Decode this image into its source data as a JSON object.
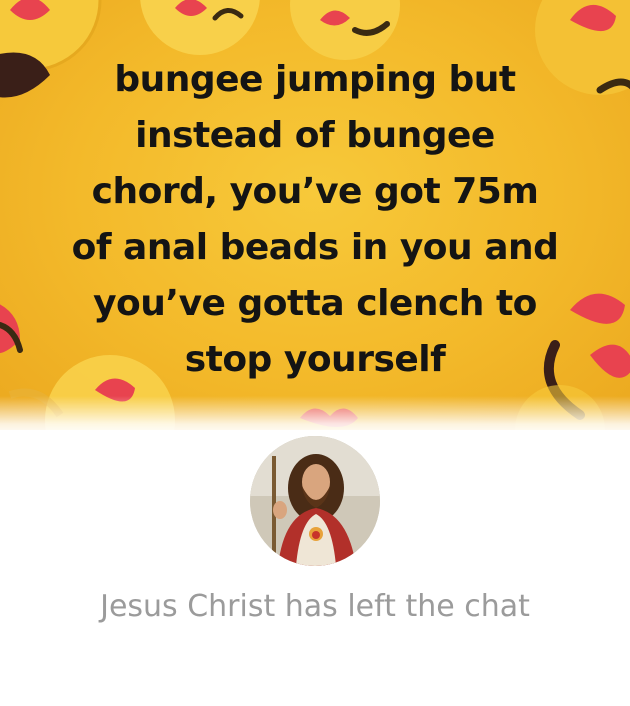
{
  "meme": {
    "caption_lines": [
      "bungee jumping but",
      "instead of bungee",
      "chord, you’ve got 75m",
      "of anal beads in you and",
      "you’ve gotta clench to",
      "stop yourself"
    ]
  },
  "chat": {
    "avatar_icon": "jesus-portrait",
    "system_message": "Jesus Christ has left the chat"
  },
  "colors": {
    "banner_yellow": "#f3b92a",
    "emoji_yellow": "#f6c93b",
    "heart_red": "#e8434f",
    "caption_text": "#141414",
    "system_text": "#9b9b9b",
    "background": "#ffffff"
  }
}
